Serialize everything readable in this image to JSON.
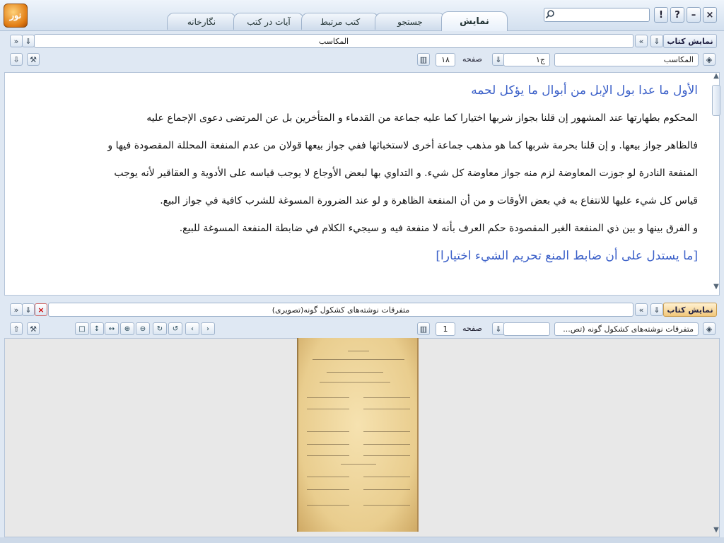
{
  "app": {
    "logo_text": "نور"
  },
  "tabs": [
    {
      "label": "نمایش",
      "active": true
    },
    {
      "label": "جستجو",
      "active": false
    },
    {
      "label": "کتب مرتبط",
      "active": false
    },
    {
      "label": "آیات در کتب",
      "active": false
    },
    {
      "label": "نگارخانه",
      "active": false
    }
  ],
  "window_buttons": {
    "alert": "!",
    "help": "?",
    "minimize": "–",
    "close": "×"
  },
  "search": {
    "value": ""
  },
  "top_pane": {
    "show_book_label": "نمایش کتاب",
    "book_title": "المکاسب",
    "book_field": "المکاسب",
    "volume_field": "ج۱",
    "page_label": "صفحه",
    "page_value": "۱۸"
  },
  "text": {
    "heading": "الأول ما عدا بول الإبل من أبوال ما يؤكل لحمه",
    "lines": [
      "المحكوم بطهارتها عند المشهور إن قلنا بجواز شربها اختيارا كما عليه جماعة من القدماء و المتأخرين بل عن المرتضى دعوى الإجماع عليه",
      "فالظاهر جواز بيعها. و إن قلنا بحرمة شربها كما هو مذهب جماعة أخرى لاستخباثها ففي جواز بيعها قولان من عدم المنفعة المحللة المقصودة فيها و",
      "المنفعة النادرة لو جوزت المعاوضة لزم منه جواز معاوضة كل شيء. و التداوي بها لبعض الأوجاع لا يوجب قياسه على الأدوية و العقاقير لأنه يوجب",
      "قياس كل شيء عليها للانتفاع به في بعض الأوقات و من أن المنفعة الظاهرة و لو عند الضرورة المسوغة للشرب كافية في جواز البيع.",
      "و الفرق بينها و بين ذي المنفعة الغير المقصودة حكم العرف بأنه لا منفعة فيه و سيجيء الكلام في ضابطة المنفعة المسوغة للبيع."
    ],
    "heading2": "[ما يستدل على أن ضابط المنع تحريم الشيء اختيارا]"
  },
  "bottom_pane": {
    "show_book_label": "نمایش کتاب",
    "book_title": "متفرقات نوشته‌های کشکول گونه(تصویری)",
    "book_field": "متفرقات نوشته‌های کشکول گونه (تص...",
    "page_label": "صفحه",
    "page_value": "1"
  },
  "colors": {
    "heading": "#3a5fc8",
    "accent_orange": "#e07b12",
    "chrome": "#dfe8f3"
  }
}
